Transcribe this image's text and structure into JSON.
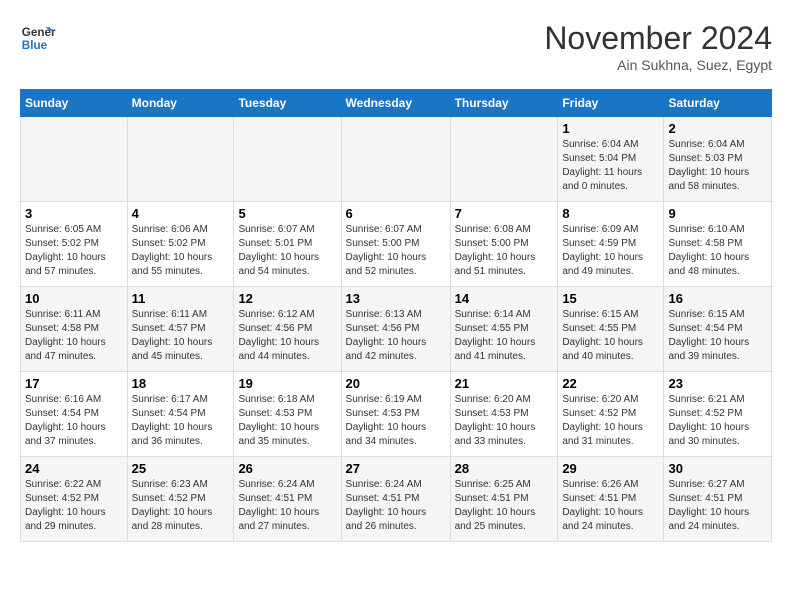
{
  "header": {
    "logo_line1": "General",
    "logo_line2": "Blue",
    "month_title": "November 2024",
    "subtitle": "Ain Sukhna, Suez, Egypt"
  },
  "days_of_week": [
    "Sunday",
    "Monday",
    "Tuesday",
    "Wednesday",
    "Thursday",
    "Friday",
    "Saturday"
  ],
  "weeks": [
    [
      {
        "day": "",
        "info": ""
      },
      {
        "day": "",
        "info": ""
      },
      {
        "day": "",
        "info": ""
      },
      {
        "day": "",
        "info": ""
      },
      {
        "day": "",
        "info": ""
      },
      {
        "day": "1",
        "info": "Sunrise: 6:04 AM\nSunset: 5:04 PM\nDaylight: 11 hours\nand 0 minutes."
      },
      {
        "day": "2",
        "info": "Sunrise: 6:04 AM\nSunset: 5:03 PM\nDaylight: 10 hours\nand 58 minutes."
      }
    ],
    [
      {
        "day": "3",
        "info": "Sunrise: 6:05 AM\nSunset: 5:02 PM\nDaylight: 10 hours\nand 57 minutes."
      },
      {
        "day": "4",
        "info": "Sunrise: 6:06 AM\nSunset: 5:02 PM\nDaylight: 10 hours\nand 55 minutes."
      },
      {
        "day": "5",
        "info": "Sunrise: 6:07 AM\nSunset: 5:01 PM\nDaylight: 10 hours\nand 54 minutes."
      },
      {
        "day": "6",
        "info": "Sunrise: 6:07 AM\nSunset: 5:00 PM\nDaylight: 10 hours\nand 52 minutes."
      },
      {
        "day": "7",
        "info": "Sunrise: 6:08 AM\nSunset: 5:00 PM\nDaylight: 10 hours\nand 51 minutes."
      },
      {
        "day": "8",
        "info": "Sunrise: 6:09 AM\nSunset: 4:59 PM\nDaylight: 10 hours\nand 49 minutes."
      },
      {
        "day": "9",
        "info": "Sunrise: 6:10 AM\nSunset: 4:58 PM\nDaylight: 10 hours\nand 48 minutes."
      }
    ],
    [
      {
        "day": "10",
        "info": "Sunrise: 6:11 AM\nSunset: 4:58 PM\nDaylight: 10 hours\nand 47 minutes."
      },
      {
        "day": "11",
        "info": "Sunrise: 6:11 AM\nSunset: 4:57 PM\nDaylight: 10 hours\nand 45 minutes."
      },
      {
        "day": "12",
        "info": "Sunrise: 6:12 AM\nSunset: 4:56 PM\nDaylight: 10 hours\nand 44 minutes."
      },
      {
        "day": "13",
        "info": "Sunrise: 6:13 AM\nSunset: 4:56 PM\nDaylight: 10 hours\nand 42 minutes."
      },
      {
        "day": "14",
        "info": "Sunrise: 6:14 AM\nSunset: 4:55 PM\nDaylight: 10 hours\nand 41 minutes."
      },
      {
        "day": "15",
        "info": "Sunrise: 6:15 AM\nSunset: 4:55 PM\nDaylight: 10 hours\nand 40 minutes."
      },
      {
        "day": "16",
        "info": "Sunrise: 6:15 AM\nSunset: 4:54 PM\nDaylight: 10 hours\nand 39 minutes."
      }
    ],
    [
      {
        "day": "17",
        "info": "Sunrise: 6:16 AM\nSunset: 4:54 PM\nDaylight: 10 hours\nand 37 minutes."
      },
      {
        "day": "18",
        "info": "Sunrise: 6:17 AM\nSunset: 4:54 PM\nDaylight: 10 hours\nand 36 minutes."
      },
      {
        "day": "19",
        "info": "Sunrise: 6:18 AM\nSunset: 4:53 PM\nDaylight: 10 hours\nand 35 minutes."
      },
      {
        "day": "20",
        "info": "Sunrise: 6:19 AM\nSunset: 4:53 PM\nDaylight: 10 hours\nand 34 minutes."
      },
      {
        "day": "21",
        "info": "Sunrise: 6:20 AM\nSunset: 4:53 PM\nDaylight: 10 hours\nand 33 minutes."
      },
      {
        "day": "22",
        "info": "Sunrise: 6:20 AM\nSunset: 4:52 PM\nDaylight: 10 hours\nand 31 minutes."
      },
      {
        "day": "23",
        "info": "Sunrise: 6:21 AM\nSunset: 4:52 PM\nDaylight: 10 hours\nand 30 minutes."
      }
    ],
    [
      {
        "day": "24",
        "info": "Sunrise: 6:22 AM\nSunset: 4:52 PM\nDaylight: 10 hours\nand 29 minutes."
      },
      {
        "day": "25",
        "info": "Sunrise: 6:23 AM\nSunset: 4:52 PM\nDaylight: 10 hours\nand 28 minutes."
      },
      {
        "day": "26",
        "info": "Sunrise: 6:24 AM\nSunset: 4:51 PM\nDaylight: 10 hours\nand 27 minutes."
      },
      {
        "day": "27",
        "info": "Sunrise: 6:24 AM\nSunset: 4:51 PM\nDaylight: 10 hours\nand 26 minutes."
      },
      {
        "day": "28",
        "info": "Sunrise: 6:25 AM\nSunset: 4:51 PM\nDaylight: 10 hours\nand 25 minutes."
      },
      {
        "day": "29",
        "info": "Sunrise: 6:26 AM\nSunset: 4:51 PM\nDaylight: 10 hours\nand 24 minutes."
      },
      {
        "day": "30",
        "info": "Sunrise: 6:27 AM\nSunset: 4:51 PM\nDaylight: 10 hours\nand 24 minutes."
      }
    ]
  ]
}
